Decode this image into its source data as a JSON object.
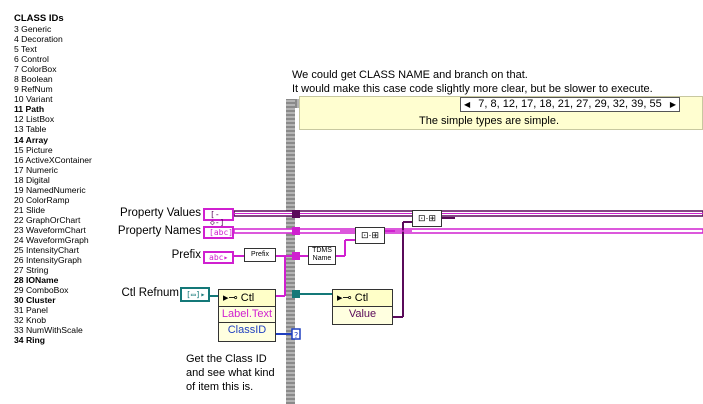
{
  "class_ids": {
    "title": "CLASS IDs",
    "items": [
      {
        "text": "3 Generic",
        "bold": false
      },
      {
        "text": "4 Decoration",
        "bold": false
      },
      {
        "text": "5 Text",
        "bold": false
      },
      {
        "text": "6 Control",
        "bold": false
      },
      {
        "text": "7 ColorBox",
        "bold": false
      },
      {
        "text": "8 Boolean",
        "bold": false
      },
      {
        "text": "9 RefNum",
        "bold": false
      },
      {
        "text": "10 Variant",
        "bold": false
      },
      {
        "text": "11 Path",
        "bold": true
      },
      {
        "text": "12 ListBox",
        "bold": false
      },
      {
        "text": "13 Table",
        "bold": false
      },
      {
        "text": "14 Array",
        "bold": true
      },
      {
        "text": "15 Picture",
        "bold": false
      },
      {
        "text": "16 ActiveXContainer",
        "bold": false
      },
      {
        "text": "17 Numeric",
        "bold": false
      },
      {
        "text": "18 Digital",
        "bold": false
      },
      {
        "text": "19 NamedNumeric",
        "bold": false
      },
      {
        "text": "20 ColorRamp",
        "bold": false
      },
      {
        "text": "21 Slide",
        "bold": false
      },
      {
        "text": "22 GraphOrChart",
        "bold": false
      },
      {
        "text": "23 WaveformChart",
        "bold": false
      },
      {
        "text": "24 WaveformGraph",
        "bold": false
      },
      {
        "text": "25 IntensityChart",
        "bold": false
      },
      {
        "text": "26 IntensityGraph",
        "bold": false
      },
      {
        "text": "27 String",
        "bold": false
      },
      {
        "text": "28 IOName",
        "bold": true
      },
      {
        "text": "29 ComboBox",
        "bold": false
      },
      {
        "text": "30 Cluster",
        "bold": true
      },
      {
        "text": "31 Panel",
        "bold": false
      },
      {
        "text": "32 Knob",
        "bold": false
      },
      {
        "text": "33 NumWithScale",
        "bold": false
      },
      {
        "text": "34 Ring",
        "bold": true
      }
    ]
  },
  "comment_top": {
    "line1": "We could get CLASS NAME and branch on that.",
    "line2": "It would make this case code slightly more clear, but be slower to execute."
  },
  "case_structure": {
    "selector_value": "7, 8, 12, 17, 18, 21, 27, 29, 32, 39, 55",
    "note": "The simple types are simple."
  },
  "terminals": {
    "property_values": "Property Values",
    "property_names": "Property Names",
    "prefix": "Prefix",
    "ctl_refnum": "Ctl Refnum"
  },
  "prefix_tag": "Prefix",
  "tdms_tag": "TDMS Name",
  "property_node_1": {
    "class": "Ctl",
    "prop1": "Label.Text",
    "prop2": "ClassID"
  },
  "property_node_2": {
    "class": "Ctl",
    "prop1": "Value"
  },
  "comment_bottom": {
    "line1": "Get the Class ID",
    "line2": "and see what kind",
    "line3": "of item this is."
  },
  "colors": {
    "string_wire": "#d020d0",
    "refnum_wire": "#147878",
    "variant_wire": "#5a0a5a",
    "int_wire": "#2040c0"
  },
  "icons": {
    "variant_terminal": "variant-icon",
    "string_terminal": "string-abc-icon",
    "refnum_terminal": "refnum-icon",
    "build_array": "build-array-icon"
  }
}
